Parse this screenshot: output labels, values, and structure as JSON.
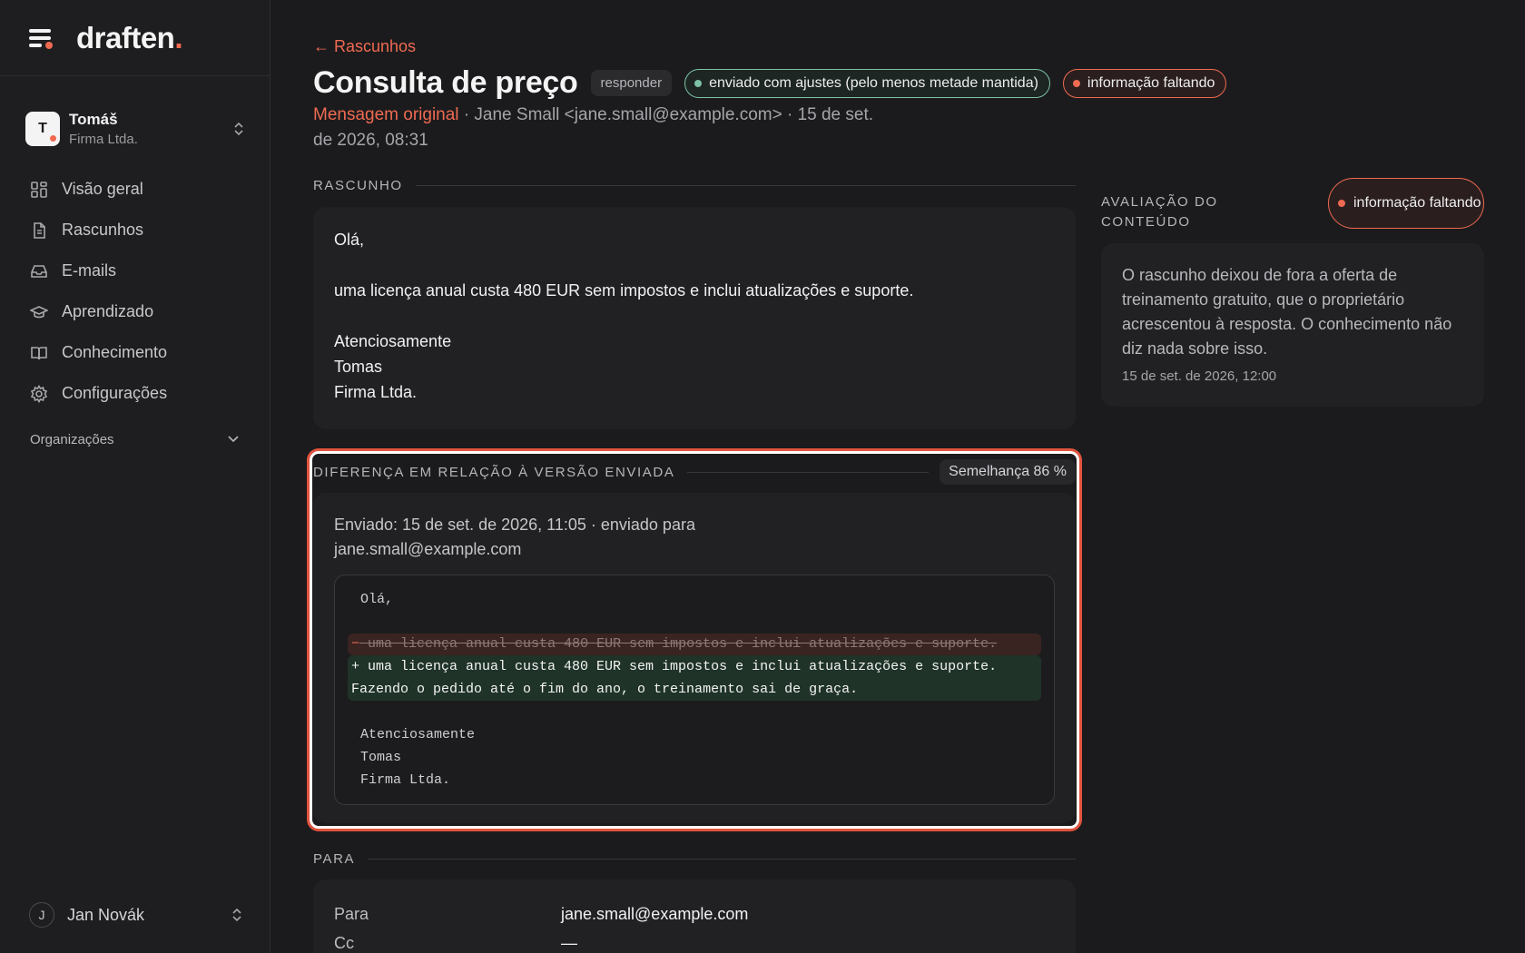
{
  "brand": {
    "name": "draften",
    "dot": "."
  },
  "org": {
    "initial": "T",
    "name": "Tomáš",
    "company": "Firma Ltda."
  },
  "nav": [
    {
      "label": "Visão geral",
      "icon": "grid-icon"
    },
    {
      "label": "Rascunhos",
      "icon": "document-icon"
    },
    {
      "label": "E-mails",
      "icon": "inbox-icon"
    },
    {
      "label": "Aprendizado",
      "icon": "graduation-cap-icon"
    },
    {
      "label": "Conhecimento",
      "icon": "book-icon"
    },
    {
      "label": "Configurações",
      "icon": "gear-icon"
    }
  ],
  "organizations_label": "Organizações",
  "user": {
    "initial": "J",
    "name": "Jan Novák"
  },
  "header": {
    "back": "← Rascunhos",
    "title": "Consulta de preço",
    "type_badge": "responder",
    "status_sent": "enviado com ajustes (pelo menos metade mantida)",
    "status_missing": "informação faltando",
    "original_link": "Mensagem original",
    "meta": " · Jane Small <jane.small@example.com> · 15 de set. de 2026, 08:31"
  },
  "draft": {
    "label": "Rascunho",
    "lines": [
      "Olá,",
      "",
      "uma licença anual custa 480 EUR sem impostos e inclui atualizações e suporte.",
      "",
      "Atenciosamente",
      "Tomas",
      "Firma Ltda."
    ]
  },
  "diff": {
    "label": "Diferença em relação à versão enviada",
    "similarity": "Semelhança 86 %",
    "sent_meta": "Enviado: 15 de set. de 2026, 11:05 · enviado para jane.small@example.com",
    "context_top": [
      "Olá,",
      ""
    ],
    "removed": "uma licença anual custa 480 EUR sem impostos e inclui atualizações e suporte.",
    "added": "+ uma licença anual custa 480 EUR sem impostos e inclui atualizações e suporte. Fazendo o pedido até o fim do ano, o treinamento sai de graça.",
    "context_bottom": [
      "",
      "Atenciosamente",
      "Tomas",
      "Firma Ltda."
    ]
  },
  "para": {
    "label": "Para",
    "rows": [
      {
        "k": "Para",
        "v": "jane.small@example.com"
      },
      {
        "k": "Cc",
        "v": "—"
      }
    ]
  },
  "evaluation": {
    "label": "Avaliação do conteúdo",
    "badge": "informação faltando",
    "text": "O rascunho deixou de fora a oferta de treinamento gratuito, que o proprietário acrescentou à resposta. O conhecimento não diz nada sobre isso.",
    "date": "15 de set. de 2026, 12:00"
  },
  "colors": {
    "accent": "#ef6a51",
    "success": "#7dc2a6",
    "background": "#1b1b1d"
  }
}
